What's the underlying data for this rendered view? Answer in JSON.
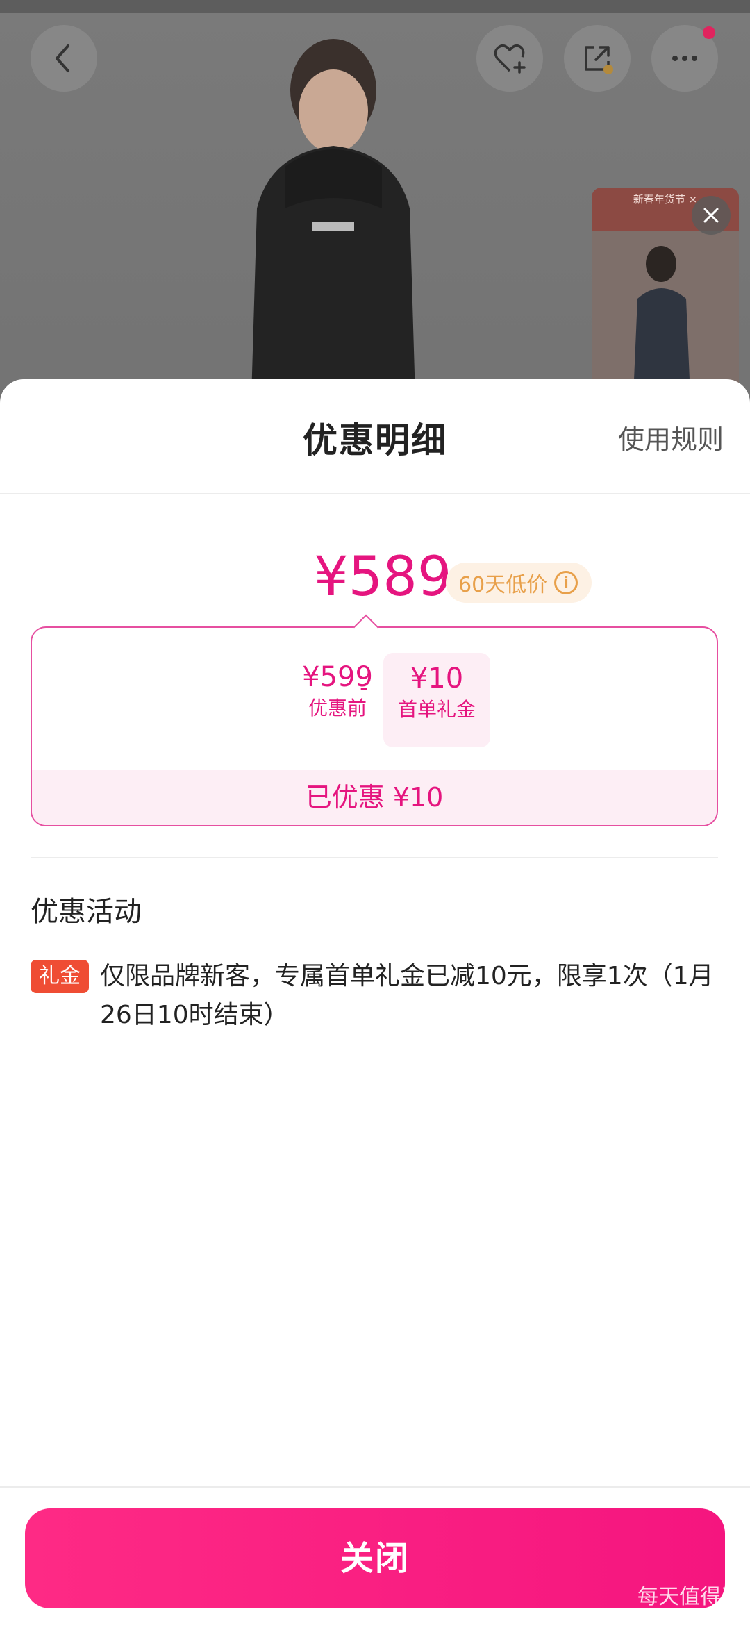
{
  "header": {
    "title": "优惠明细",
    "rules_link": "使用规则"
  },
  "icons": {
    "back": "chevron-left-icon",
    "favorite": "heart-plus-icon",
    "share": "share-icon",
    "more": "more-icon",
    "close_video": "close-icon",
    "info": "info-icon"
  },
  "floating_video": {
    "banner": "新春年货节 ×"
  },
  "price": {
    "final": "¥589",
    "low_badge": "60天低价",
    "info_glyph": "i"
  },
  "breakdown": {
    "before_value": "¥599",
    "before_label": "优惠前",
    "minus": "-",
    "gift_value": "¥10",
    "gift_label": "首单礼金",
    "saved": "已优惠 ¥10"
  },
  "promotions": {
    "title": "优惠活动",
    "items": [
      {
        "tag": "礼金",
        "text": "仅限品牌新客，专属首单礼金已减10元，限享1次（1月26日10时结束）"
      }
    ]
  },
  "footer": {
    "close_label": "关闭",
    "watermark": "每天值得买",
    "watermark_url": "zhizhizhi.com"
  },
  "colors": {
    "accent": "#e5157f",
    "button": "#fe2a85",
    "badge_text": "#e8a04a",
    "promo_tag": "#ef4d34"
  }
}
